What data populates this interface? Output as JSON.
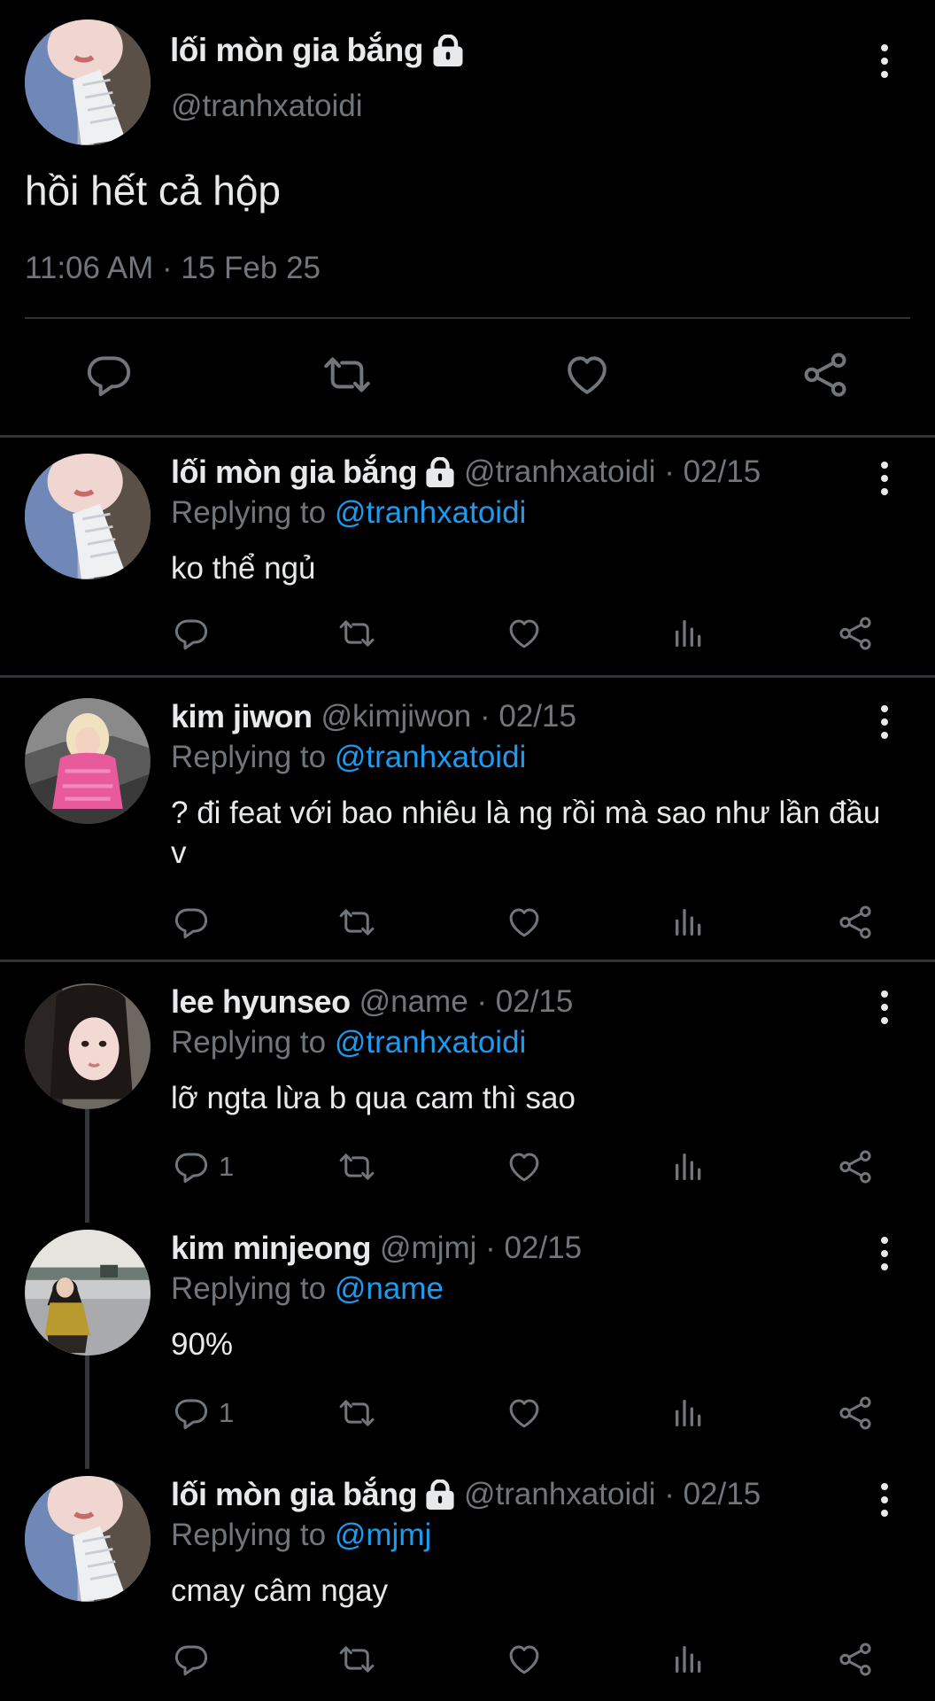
{
  "main_tweet": {
    "author_name": "lối mòn gia bắng",
    "author_handle": "@tranhxatoidi",
    "text": "hồi hết cả hộp",
    "timestamp": "11:06 AM · 15 Feb 25",
    "actions": [
      "reply-icon",
      "retweet-icon",
      "like-icon",
      "share-icon"
    ]
  },
  "replies": [
    {
      "name": "lối mòn gia bắng",
      "locked": true,
      "meta": "@tranhxatoidi · 02/15",
      "replying_label": "Replying to",
      "replying_to": "@tranhxatoidi",
      "text": "ko thể ngủ",
      "reply_count": ""
    },
    {
      "name": "kim jiwon",
      "locked": false,
      "meta": "@kimjiwon · 02/15",
      "replying_label": "Replying to",
      "replying_to": "@tranhxatoidi",
      "text": "? đi feat với bao nhiêu là ng rồi mà sao như lần đầu v",
      "reply_count": ""
    },
    {
      "name": "lee hyunseo",
      "locked": false,
      "meta": "@name · 02/15",
      "replying_label": "Replying to",
      "replying_to": "@tranhxatoidi",
      "text": "lỡ ngta lừa b qua cam thì sao",
      "reply_count": "1"
    },
    {
      "name": "kim minjeong",
      "locked": false,
      "meta": "@mjmj · 02/15",
      "replying_label": "Replying to",
      "replying_to": "@name",
      "text": "90%",
      "reply_count": "1"
    },
    {
      "name": "lối mòn gia bắng",
      "locked": true,
      "meta": "@tranhxatoidi · 02/15",
      "replying_label": "Replying to",
      "replying_to": "@mjmj",
      "text": "cmay câm ngay",
      "reply_count": ""
    }
  ],
  "colors": {
    "background": "#000000",
    "text": "#e7e9ea",
    "muted": "#71767b",
    "link": "#1d9bf0",
    "divider": "#2f3336"
  }
}
